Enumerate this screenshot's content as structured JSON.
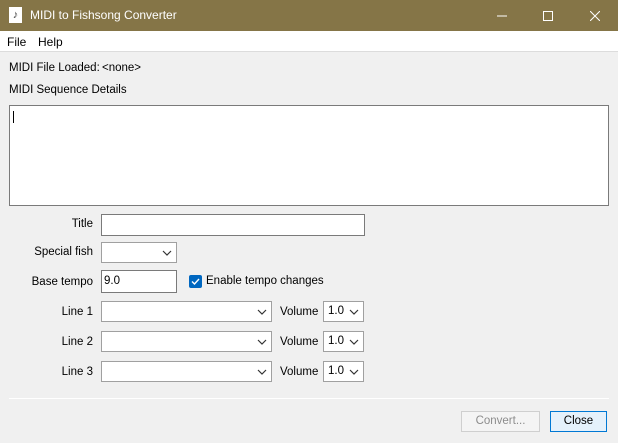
{
  "window": {
    "title": "MIDI to Fishsong Converter",
    "app_icon_glyph": "♪",
    "titlebar_color": "#857547"
  },
  "menu": {
    "items": [
      "File",
      "Help"
    ]
  },
  "midi_file": {
    "label": "MIDI File Loaded:",
    "value": "<none>"
  },
  "sequence_details": {
    "label": "MIDI Sequence Details",
    "text": ""
  },
  "title_field": {
    "label": "Title",
    "value": ""
  },
  "special_fish": {
    "label": "Special fish",
    "value": ""
  },
  "base_tempo": {
    "label": "Base tempo",
    "value": "9.0"
  },
  "tempo_changes": {
    "label": "Enable tempo changes",
    "checked": true,
    "accent": "#0067c0"
  },
  "lines": [
    {
      "label": "Line 1",
      "value": "",
      "volume_label": "Volume",
      "volume": "1.0"
    },
    {
      "label": "Line 2",
      "value": "",
      "volume_label": "Volume",
      "volume": "1.0"
    },
    {
      "label": "Line 3",
      "value": "",
      "volume_label": "Volume",
      "volume": "1.0"
    }
  ],
  "buttons": {
    "convert": "Convert...",
    "close": "Close"
  }
}
